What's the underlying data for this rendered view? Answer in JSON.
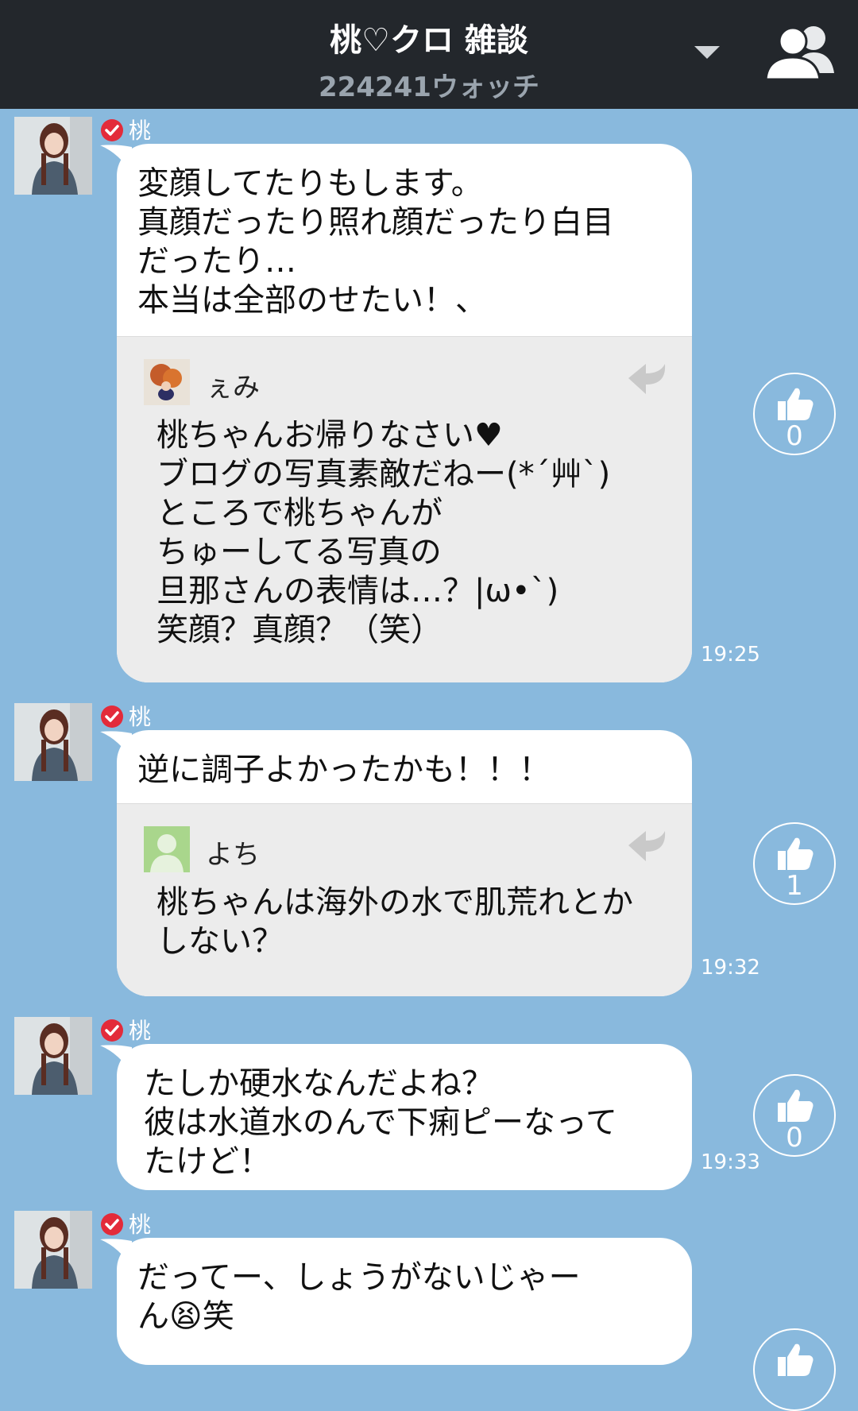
{
  "header": {
    "title": "桃♡クロ 雑談",
    "watch_count": "224241ウォッチ"
  },
  "colors": {
    "background": "#89b9dd",
    "header_bg": "#23272c",
    "bubble": "#ffffff",
    "reply_bg": "#ececec",
    "verified": "#e32b3a"
  },
  "messages": [
    {
      "author": "桃",
      "text": "変顔してたりもします。\n真顔だったり照れ顔だったり白目\nだったり…\n本当は全部のせたい！、",
      "reply": {
        "name": "ぇみ",
        "text": "桃ちゃんお帰りなさい♥\nブログの写真素敵だねー(*´艸`)\nところで桃ちゃんが\nちゅーしてる写真の\n旦那さんの表情は…？|ω•`)\n笑顔？真顔？（笑）"
      },
      "time": "19:25",
      "likes": "0"
    },
    {
      "author": "桃",
      "text": "逆に調子よかったかも！！！",
      "reply": {
        "name": "よち",
        "text": "桃ちゃんは海外の水で肌荒れとか\nしない？"
      },
      "time": "19:32",
      "likes": "1"
    },
    {
      "author": "桃",
      "text": "たしか硬水なんだよね？\n彼は水道水のんで下痢ピーなって\nたけど！",
      "time": "19:33",
      "likes": "0"
    },
    {
      "author": "桃",
      "text": "だってー、しょうがないじゃー\nん😫笑"
    }
  ]
}
